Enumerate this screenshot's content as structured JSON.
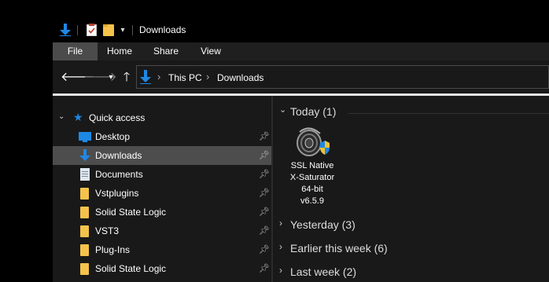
{
  "window": {
    "title": "Downloads"
  },
  "ribbon": {
    "tabs": [
      "File",
      "Home",
      "Share",
      "View"
    ]
  },
  "address": {
    "crumbs": [
      "This PC",
      "Downloads"
    ]
  },
  "nav": {
    "quick_access": "Quick access",
    "items": [
      {
        "label": "Desktop",
        "icon": "desktop-icon",
        "pinned": true
      },
      {
        "label": "Downloads",
        "icon": "download-arrow-icon",
        "pinned": true,
        "selected": true
      },
      {
        "label": "Documents",
        "icon": "documents-icon",
        "pinned": true
      },
      {
        "label": "Vstplugins",
        "icon": "folder-icon",
        "pinned": true
      },
      {
        "label": "Solid State Logic",
        "icon": "folder-icon",
        "pinned": true
      },
      {
        "label": "VST3",
        "icon": "folder-icon",
        "pinned": true
      },
      {
        "label": "Plug-Ins",
        "icon": "folder-icon",
        "pinned": true
      },
      {
        "label": "Solid State Logic",
        "icon": "folder-icon",
        "pinned": true
      }
    ]
  },
  "content": {
    "groups": [
      {
        "label": "Today (1)",
        "expanded": true
      },
      {
        "label": "Yesterday (3)",
        "expanded": false
      },
      {
        "label": "Earlier this week (6)",
        "expanded": false
      },
      {
        "label": "Last week (2)",
        "expanded": false
      }
    ],
    "files": [
      {
        "lines": [
          "SSL Native",
          "X-Saturator",
          "64-bit",
          "v6.5.9"
        ],
        "icon": "installer-shield-icon"
      }
    ]
  },
  "colors": {
    "window_bg": "#191919",
    "selected_bg": "#4d4d4d",
    "accent_blue": "#1e88e5",
    "folder_yellow": "#f5c34b"
  }
}
